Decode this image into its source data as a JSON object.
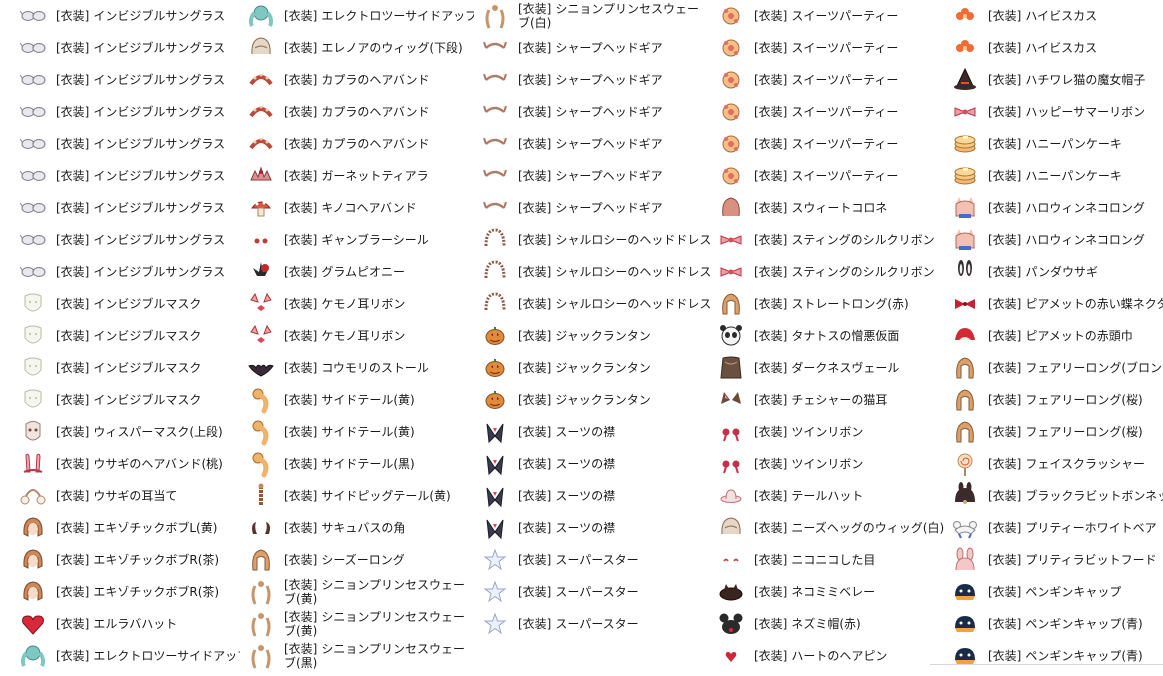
{
  "prefix": "[衣装]",
  "columns": [
    {
      "items": [
        {
          "name": "インビジブルサングラス",
          "icon": "sunglasses-icon"
        },
        {
          "name": "インビジブルサングラス",
          "icon": "sunglasses-icon"
        },
        {
          "name": "インビジブルサングラス",
          "icon": "sunglasses-icon"
        },
        {
          "name": "インビジブルサングラス",
          "icon": "sunglasses-icon"
        },
        {
          "name": "インビジブルサングラス",
          "icon": "sunglasses-icon"
        },
        {
          "name": "インビジブルサングラス",
          "icon": "sunglasses-icon"
        },
        {
          "name": "インビジブルサングラス",
          "icon": "sunglasses-icon"
        },
        {
          "name": "インビジブルサングラス",
          "icon": "sunglasses-icon"
        },
        {
          "name": "インビジブルサングラス",
          "icon": "sunglasses-icon"
        },
        {
          "name": "インビジブルマスク",
          "icon": "mask-icon"
        },
        {
          "name": "インビジブルマスク",
          "icon": "mask-icon"
        },
        {
          "name": "インビジブルマスク",
          "icon": "mask-icon"
        },
        {
          "name": "インビジブルマスク",
          "icon": "mask-icon"
        },
        {
          "name": "ウィスパーマスク(上段)",
          "icon": "whisper-mask-icon"
        },
        {
          "name": "ウサギのヘアバンド(桃)",
          "icon": "bunny-hairband-icon"
        },
        {
          "name": "ウサギの耳当て",
          "icon": "earmuffs-icon"
        },
        {
          "name": "エキゾチックボブL(黄)",
          "icon": "bob-hair-icon"
        },
        {
          "name": "エキゾチックボブR(茶)",
          "icon": "bob-hair-icon"
        },
        {
          "name": "エキゾチックボブR(茶)",
          "icon": "bob-hair-icon"
        },
        {
          "name": "エルラバハット",
          "icon": "heart-hat-icon"
        },
        {
          "name": "エレクトロツーサイドアップ",
          "icon": "twin-tail-hair-icon"
        }
      ]
    },
    {
      "items": [
        {
          "name": "エレクトロツーサイドアップ",
          "icon": "twin-tail-hair-icon"
        },
        {
          "name": "エレノアのウィッグ(下段)",
          "icon": "wig-icon"
        },
        {
          "name": "カプラのヘアバンド",
          "icon": "hairband-icon"
        },
        {
          "name": "カプラのヘアバンド",
          "icon": "hairband-icon"
        },
        {
          "name": "カプラのヘアバンド",
          "icon": "hairband-icon"
        },
        {
          "name": "ガーネットティアラ",
          "icon": "tiara-icon"
        },
        {
          "name": "キノコヘアバンド",
          "icon": "mushroom-icon"
        },
        {
          "name": "ギャンブラーシール",
          "icon": "seal-icon"
        },
        {
          "name": "グラムピオニー",
          "icon": "peony-icon"
        },
        {
          "name": "ケモノ耳リボン",
          "icon": "ear-ribbon-icon"
        },
        {
          "name": "ケモノ耳リボン",
          "icon": "ear-ribbon-icon"
        },
        {
          "name": "コウモリのストール",
          "icon": "bat-icon"
        },
        {
          "name": "サイドテール(黄)",
          "icon": "side-tail-icon"
        },
        {
          "name": "サイドテール(黄)",
          "icon": "side-tail-icon"
        },
        {
          "name": "サイドテール(黒)",
          "icon": "side-tail-icon"
        },
        {
          "name": "サイドピッグテール(黄)",
          "icon": "pigtail-icon"
        },
        {
          "name": "サキュバスの角",
          "icon": "horns-icon"
        },
        {
          "name": "シーズーロング",
          "icon": "long-hair-icon"
        },
        {
          "name": "シニョンプリンセスウェーブ(黄)",
          "icon": "princess-wave-icon",
          "wrap": true
        },
        {
          "name": "シニョンプリンセスウェーブ(黄)",
          "icon": "princess-wave-icon",
          "wrap": true
        },
        {
          "name": "シニョンプリンセスウェーブ(黒)",
          "icon": "princess-wave-icon",
          "wrap": true
        }
      ]
    },
    {
      "items": [
        {
          "name": "シニョンプリンセスウェーブ(白)",
          "icon": "princess-wave-icon",
          "wrap": true
        },
        {
          "name": "シャープヘッドギア",
          "icon": "headgear-icon"
        },
        {
          "name": "シャープヘッドギア",
          "icon": "headgear-icon"
        },
        {
          "name": "シャープヘッドギア",
          "icon": "headgear-icon"
        },
        {
          "name": "シャープヘッドギア",
          "icon": "headgear-icon"
        },
        {
          "name": "シャープヘッドギア",
          "icon": "headgear-icon"
        },
        {
          "name": "シャープヘッドギア",
          "icon": "headgear-icon"
        },
        {
          "name": "シャルロシーのヘッドドレス",
          "icon": "headdress-icon"
        },
        {
          "name": "シャルロシーのヘッドドレス",
          "icon": "headdress-icon"
        },
        {
          "name": "シャルロシーのヘッドドレス",
          "icon": "headdress-icon"
        },
        {
          "name": "ジャックランタン",
          "icon": "pumpkin-icon"
        },
        {
          "name": "ジャックランタン",
          "icon": "pumpkin-icon"
        },
        {
          "name": "ジャックランタン",
          "icon": "pumpkin-icon"
        },
        {
          "name": "スーツの襟",
          "icon": "suit-collar-icon"
        },
        {
          "name": "スーツの襟",
          "icon": "suit-collar-icon"
        },
        {
          "name": "スーツの襟",
          "icon": "suit-collar-icon"
        },
        {
          "name": "スーツの襟",
          "icon": "suit-collar-icon"
        },
        {
          "name": "スーパースター",
          "icon": "star-icon"
        },
        {
          "name": "スーパースター",
          "icon": "star-icon"
        },
        {
          "name": "スーパースター",
          "icon": "star-icon"
        }
      ]
    },
    {
      "items": [
        {
          "name": "スイーツパーティー",
          "icon": "sweets-icon"
        },
        {
          "name": "スイーツパーティー",
          "icon": "sweets-icon"
        },
        {
          "name": "スイーツパーティー",
          "icon": "sweets-icon"
        },
        {
          "name": "スイーツパーティー",
          "icon": "sweets-icon"
        },
        {
          "name": "スイーツパーティー",
          "icon": "sweets-icon"
        },
        {
          "name": "スイーツパーティー",
          "icon": "sweets-icon"
        },
        {
          "name": "スウィートコロネ",
          "icon": "hair-icon"
        },
        {
          "name": "スティングのシルクリボン",
          "icon": "ribbon-icon"
        },
        {
          "name": "スティングのシルクリボン",
          "icon": "ribbon-icon"
        },
        {
          "name": "ストレートロング(赤)",
          "icon": "long-hair-icon"
        },
        {
          "name": "タナトスの憎悪仮面",
          "icon": "panda-mask-icon"
        },
        {
          "name": "ダークネスヴェール",
          "icon": "veil-icon"
        },
        {
          "name": "チェシャーの猫耳",
          "icon": "cat-ears-icon"
        },
        {
          "name": "ツインリボン",
          "icon": "twin-ribbon-icon"
        },
        {
          "name": "ツインリボン",
          "icon": "twin-ribbon-icon"
        },
        {
          "name": "テールハット",
          "icon": "hat-icon"
        },
        {
          "name": "ニーズヘッグのウィッグ(白)",
          "icon": "wig-icon"
        },
        {
          "name": "ニコニコした目",
          "icon": "eyes-icon"
        },
        {
          "name": "ネコミミベレー",
          "icon": "beret-icon"
        },
        {
          "name": "ネズミ帽(赤)",
          "icon": "mouse-hat-icon"
        },
        {
          "name": "ハートのヘアピン",
          "icon": "hairpin-icon"
        }
      ]
    },
    {
      "items": [
        {
          "name": "ハイビスカス",
          "icon": "hibiscus-icon"
        },
        {
          "name": "ハイビスカス",
          "icon": "hibiscus-icon"
        },
        {
          "name": "ハチワレ猫の魔女帽子",
          "icon": "witch-hat-icon"
        },
        {
          "name": "ハッピーサマーリボン",
          "icon": "ribbon-icon"
        },
        {
          "name": "ハニーパンケーキ",
          "icon": "pancake-icon"
        },
        {
          "name": "ハニーパンケーキ",
          "icon": "pancake-icon"
        },
        {
          "name": "ハロウィンネコロング",
          "icon": "cat-hair-icon"
        },
        {
          "name": "ハロウィンネコロング",
          "icon": "cat-hair-icon"
        },
        {
          "name": "パンダウサギ",
          "icon": "rabbit-ears-icon"
        },
        {
          "name": "ピアメットの赤い蝶ネクタイ",
          "icon": "bow-tie-icon"
        },
        {
          "name": "ピアメットの赤頭巾",
          "icon": "red-hood-icon"
        },
        {
          "name": "フェアリーロング(ブロンド)",
          "icon": "long-hair-icon"
        },
        {
          "name": "フェアリーロング(桜)",
          "icon": "long-hair-icon"
        },
        {
          "name": "フェアリーロング(桜)",
          "icon": "long-hair-icon"
        },
        {
          "name": "フェイスクラッシャー",
          "icon": "lollipop-icon"
        },
        {
          "name": "ブラックラビットボンネット",
          "icon": "bonnet-icon"
        },
        {
          "name": "プリティーホワイトベア",
          "icon": "bear-icon"
        },
        {
          "name": "プリティラビットフード",
          "icon": "rabbit-hood-icon"
        },
        {
          "name": "ペンギンキャップ",
          "icon": "penguin-cap-icon"
        },
        {
          "name": "ペンギンキャップ(青)",
          "icon": "penguin-cap-icon"
        },
        {
          "name": "ペンギンキャップ(青)",
          "icon": "penguin-cap-icon"
        }
      ]
    }
  ]
}
